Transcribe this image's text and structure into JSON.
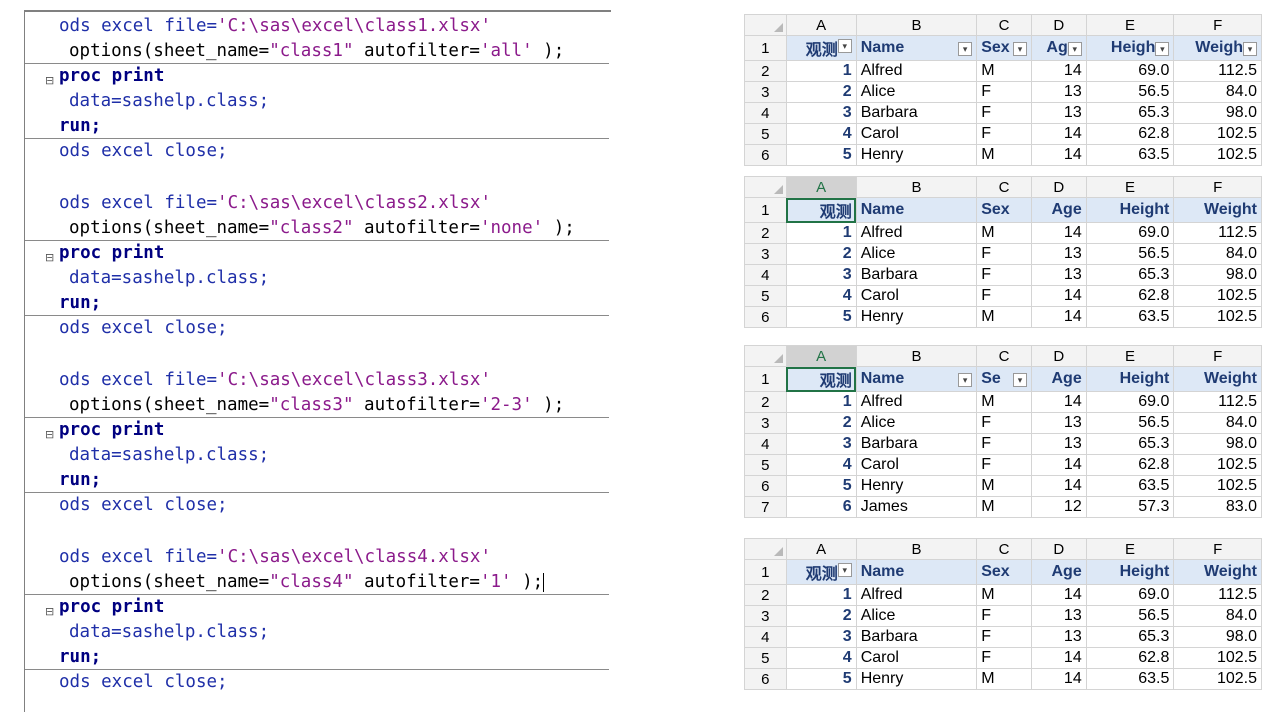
{
  "editor": {
    "blocks": [
      {
        "file_kw": "ods excel file=",
        "file_str": "'C:\\sas\\excel\\class1.xlsx'",
        "opt_kw": "options(sheet_name=",
        "sheet_str": "\"class1\"",
        "af_kw": "autofilter=",
        "af_str": "'all'",
        "opt_end": ");",
        "proc": "proc print",
        "data": "data=sashelp.class;",
        "run": "run;",
        "close": "ods excel close;"
      },
      {
        "file_kw": "ods excel file=",
        "file_str": "'C:\\sas\\excel\\class2.xlsx'",
        "opt_kw": "options(sheet_name=",
        "sheet_str": "\"class2\"",
        "af_kw": "autofilter=",
        "af_str": "'none'",
        "opt_end": ");",
        "proc": "proc print",
        "data": "data=sashelp.class;",
        "run": "run;",
        "close": "ods excel close;"
      },
      {
        "file_kw": "ods excel file=",
        "file_str": "'C:\\sas\\excel\\class3.xlsx'",
        "opt_kw": "options(sheet_name=",
        "sheet_str": "\"class3\"",
        "af_kw": "autofilter=",
        "af_str": "'2-3'",
        "opt_end": ");",
        "proc": "proc print",
        "data": "data=sashelp.class;",
        "run": "run;",
        "close": "ods excel close;"
      },
      {
        "file_kw": "ods excel file=",
        "file_str": "'C:\\sas\\excel\\class4.xlsx'",
        "opt_kw": "options(sheet_name=",
        "sheet_str": "\"class4\"",
        "af_kw": "autofilter=",
        "af_str": "'1'",
        "opt_end": ");",
        "proc": "proc print",
        "data": "data=sashelp.class;",
        "run": "run;",
        "close": "ods excel close;"
      }
    ],
    "fold_icon": "collapse-minus-icon"
  },
  "sheets": [
    {
      "col_letters": [
        "A",
        "B",
        "C",
        "D",
        "E",
        "F"
      ],
      "headers": [
        "观测",
        "Name",
        "Sex",
        "Age",
        "Height",
        "Weight"
      ],
      "header_display": [
        "观测",
        "Name",
        "Sex",
        "Ag",
        "Heigh",
        "Weigh"
      ],
      "filters": [
        true,
        true,
        true,
        true,
        true,
        true
      ],
      "rows": [
        [
          "1",
          "Alfred",
          "M",
          "14",
          "69.0",
          "112.5"
        ],
        [
          "2",
          "Alice",
          "F",
          "13",
          "56.5",
          "84.0"
        ],
        [
          "3",
          "Barbara",
          "F",
          "13",
          "65.3",
          "98.0"
        ],
        [
          "4",
          "Carol",
          "F",
          "14",
          "62.8",
          "102.5"
        ],
        [
          "5",
          "Henry",
          "M",
          "14",
          "63.5",
          "102.5"
        ]
      ]
    },
    {
      "col_letters": [
        "A",
        "B",
        "C",
        "D",
        "E",
        "F"
      ],
      "headers": [
        "观测",
        "Name",
        "Sex",
        "Age",
        "Height",
        "Weight"
      ],
      "header_display": [
        "观测",
        "Name",
        "Sex",
        "Age",
        "Height",
        "Weight"
      ],
      "filters": [
        false,
        false,
        false,
        false,
        false,
        false
      ],
      "rows": [
        [
          "1",
          "Alfred",
          "M",
          "14",
          "69.0",
          "112.5"
        ],
        [
          "2",
          "Alice",
          "F",
          "13",
          "56.5",
          "84.0"
        ],
        [
          "3",
          "Barbara",
          "F",
          "13",
          "65.3",
          "98.0"
        ],
        [
          "4",
          "Carol",
          "F",
          "14",
          "62.8",
          "102.5"
        ],
        [
          "5",
          "Henry",
          "M",
          "14",
          "63.5",
          "102.5"
        ]
      ]
    },
    {
      "col_letters": [
        "A",
        "B",
        "C",
        "D",
        "E",
        "F"
      ],
      "headers": [
        "观测",
        "Name",
        "Sex",
        "Age",
        "Height",
        "Weight"
      ],
      "header_display": [
        "观测",
        "Name",
        "Se",
        "Age",
        "Height",
        "Weight"
      ],
      "filters": [
        false,
        true,
        true,
        false,
        false,
        false
      ],
      "rows": [
        [
          "1",
          "Alfred",
          "M",
          "14",
          "69.0",
          "112.5"
        ],
        [
          "2",
          "Alice",
          "F",
          "13",
          "56.5",
          "84.0"
        ],
        [
          "3",
          "Barbara",
          "F",
          "13",
          "65.3",
          "98.0"
        ],
        [
          "4",
          "Carol",
          "F",
          "14",
          "62.8",
          "102.5"
        ],
        [
          "5",
          "Henry",
          "M",
          "14",
          "63.5",
          "102.5"
        ],
        [
          "6",
          "James",
          "M",
          "12",
          "57.3",
          "83.0"
        ]
      ]
    },
    {
      "col_letters": [
        "A",
        "B",
        "C",
        "D",
        "E",
        "F"
      ],
      "headers": [
        "观测",
        "Name",
        "Sex",
        "Age",
        "Height",
        "Weight"
      ],
      "header_display": [
        "观测",
        "Name",
        "Sex",
        "Age",
        "Height",
        "Weight"
      ],
      "filters": [
        true,
        false,
        false,
        false,
        false,
        false
      ],
      "rows": [
        [
          "1",
          "Alfred",
          "M",
          "14",
          "69.0",
          "112.5"
        ],
        [
          "2",
          "Alice",
          "F",
          "13",
          "56.5",
          "84.0"
        ],
        [
          "3",
          "Barbara",
          "F",
          "13",
          "65.3",
          "98.0"
        ],
        [
          "4",
          "Carol",
          "F",
          "14",
          "62.8",
          "102.5"
        ],
        [
          "5",
          "Henry",
          "M",
          "14",
          "63.5",
          "102.5"
        ]
      ]
    }
  ]
}
